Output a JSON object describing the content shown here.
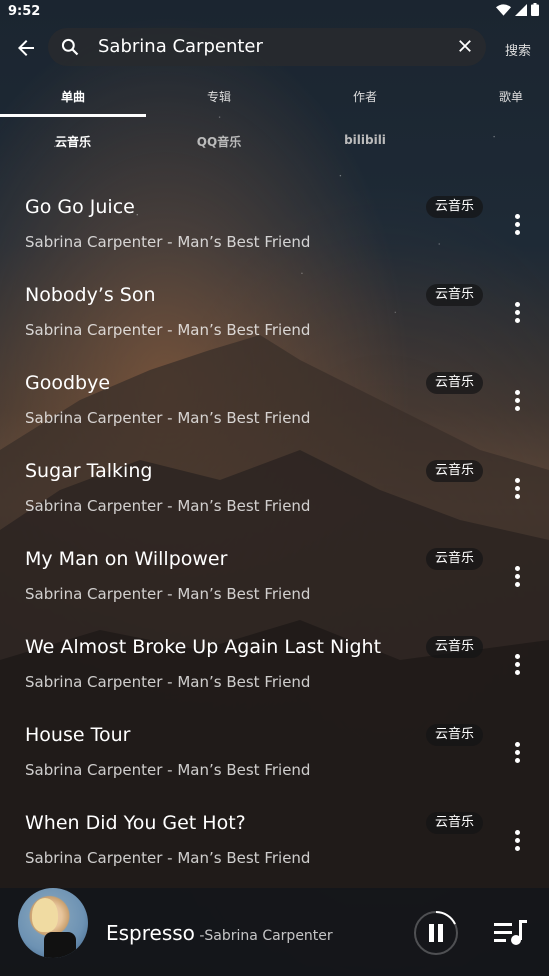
{
  "status": {
    "time": "9:52"
  },
  "search": {
    "query": "Sabrina Carpenter",
    "button": "搜索"
  },
  "tabs": [
    {
      "label": "单曲",
      "active": true
    },
    {
      "label": "专辑",
      "active": false
    },
    {
      "label": "作者",
      "active": false
    },
    {
      "label": "歌单",
      "active": false
    }
  ],
  "sources": [
    {
      "label": "云音乐",
      "active": true
    },
    {
      "label": "QQ音乐",
      "active": false
    },
    {
      "label": "bilibili",
      "active": false
    }
  ],
  "songs": [
    {
      "title": "Go Go Juice",
      "subtitle": "Sabrina Carpenter - Man’s Best Friend",
      "source": "云音乐"
    },
    {
      "title": "Nobody’s Son",
      "subtitle": "Sabrina Carpenter - Man’s Best Friend",
      "source": "云音乐"
    },
    {
      "title": "Goodbye",
      "subtitle": "Sabrina Carpenter - Man’s Best Friend",
      "source": "云音乐"
    },
    {
      "title": "Sugar Talking",
      "subtitle": "Sabrina Carpenter - Man’s Best Friend",
      "source": "云音乐"
    },
    {
      "title": "My Man on Willpower",
      "subtitle": "Sabrina Carpenter - Man’s Best Friend",
      "source": "云音乐"
    },
    {
      "title": "We Almost Broke Up Again Last Night",
      "subtitle": "Sabrina Carpenter - Man’s Best Friend",
      "source": "云音乐"
    },
    {
      "title": "House Tour",
      "subtitle": "Sabrina Carpenter - Man’s Best Friend",
      "source": "云音乐"
    },
    {
      "title": "When Did You Get Hot?",
      "subtitle": "Sabrina Carpenter - Man’s Best Friend",
      "source": "云音乐"
    }
  ],
  "player": {
    "title": "Espresso",
    "artist": " -Sabrina Carpenter",
    "progress": 0.18
  }
}
